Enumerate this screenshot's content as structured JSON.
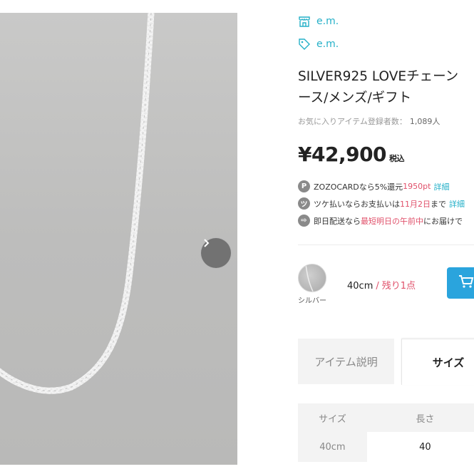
{
  "brand_shop": {
    "label": "e.m.",
    "icon": "shop-icon"
  },
  "brand_tag": {
    "label": "e.m.",
    "icon": "tag-icon"
  },
  "product": {
    "title_line1": "SILVER925 LOVEチェーン",
    "title_line2": "ース/メンズ/ギフト",
    "fav_label": "お気に入りアイテム登録者数：",
    "fav_count": "1,089人",
    "price": "¥42,900",
    "tax_label": "税込"
  },
  "benefits": [
    {
      "icon_char": "P",
      "icon": "points-icon",
      "prefix": "ZOZOCARDなら5%還元",
      "highlight": "1950pt",
      "suffix": "",
      "link": "詳細"
    },
    {
      "icon_char": "ツ",
      "icon": "tsuke-icon",
      "prefix": "ツケ払いならお支払いは",
      "highlight": "11月2日",
      "suffix": "まで",
      "link": "詳細"
    },
    {
      "icon_char": "⇨",
      "icon": "delivery-icon",
      "prefix": "即日配送なら",
      "highlight": "最短明日の午前中",
      "suffix": "にお届けで",
      "link": ""
    }
  ],
  "variant": {
    "color_label": "シルバー",
    "size": "40cm",
    "separator": "/",
    "stock": "残り1点"
  },
  "tabs": {
    "description": "アイテム説明",
    "size": "サイズ"
  },
  "size_table": {
    "headers": [
      "サイズ",
      "長さ"
    ],
    "rows": [
      [
        "40cm",
        "40"
      ]
    ]
  },
  "colors": {
    "accent": "#25b0c8",
    "highlight": "#e0506a",
    "cart": "#2aa4dd"
  }
}
